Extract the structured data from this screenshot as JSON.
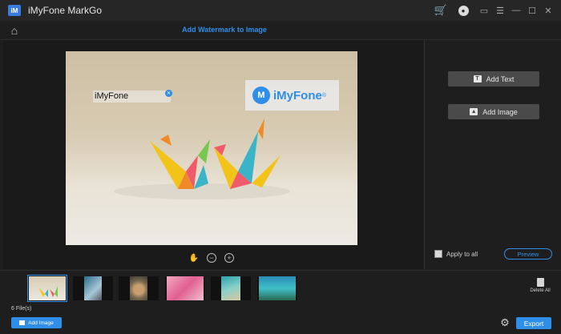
{
  "titlebar": {
    "logo_text": "iM",
    "app_title": "iMyFone MarkGo",
    "icons": [
      "cart-icon",
      "user-icon",
      "feedback-icon",
      "menu-icon",
      "minimize-icon",
      "maximize-icon",
      "close-icon"
    ]
  },
  "header": {
    "title": "Add Watermark to Image"
  },
  "canvas": {
    "text_watermark": "iMyFone",
    "logo_watermark": "iMyFone",
    "logo_registered": "®",
    "tools": [
      "hand-icon",
      "zoom-out-icon",
      "zoom-in-icon"
    ]
  },
  "right_panel": {
    "add_text_label": "Add Text",
    "add_image_label": "Add Image",
    "apply_all_label": "Apply to all",
    "apply_all_checked": false,
    "preview_label": "Preview"
  },
  "strip": {
    "file_count": "6 File(s)",
    "delete_all_label": "Delete All",
    "thumbnails": [
      {
        "theme": "paper-cranes",
        "selected": true
      },
      {
        "theme": "city-aerial",
        "selected": false
      },
      {
        "theme": "cat",
        "selected": false
      },
      {
        "theme": "pink-flatlay",
        "selected": false
      },
      {
        "theme": "beach-aerial",
        "selected": false
      },
      {
        "theme": "lagoon",
        "selected": false
      }
    ]
  },
  "footer": {
    "add_image_label": "Add Image",
    "export_label": "Export"
  },
  "colors": {
    "accent": "#2f8fe8",
    "cart": "#f0a820",
    "background": "#1e1e1e",
    "button": "#4a4a4a"
  }
}
